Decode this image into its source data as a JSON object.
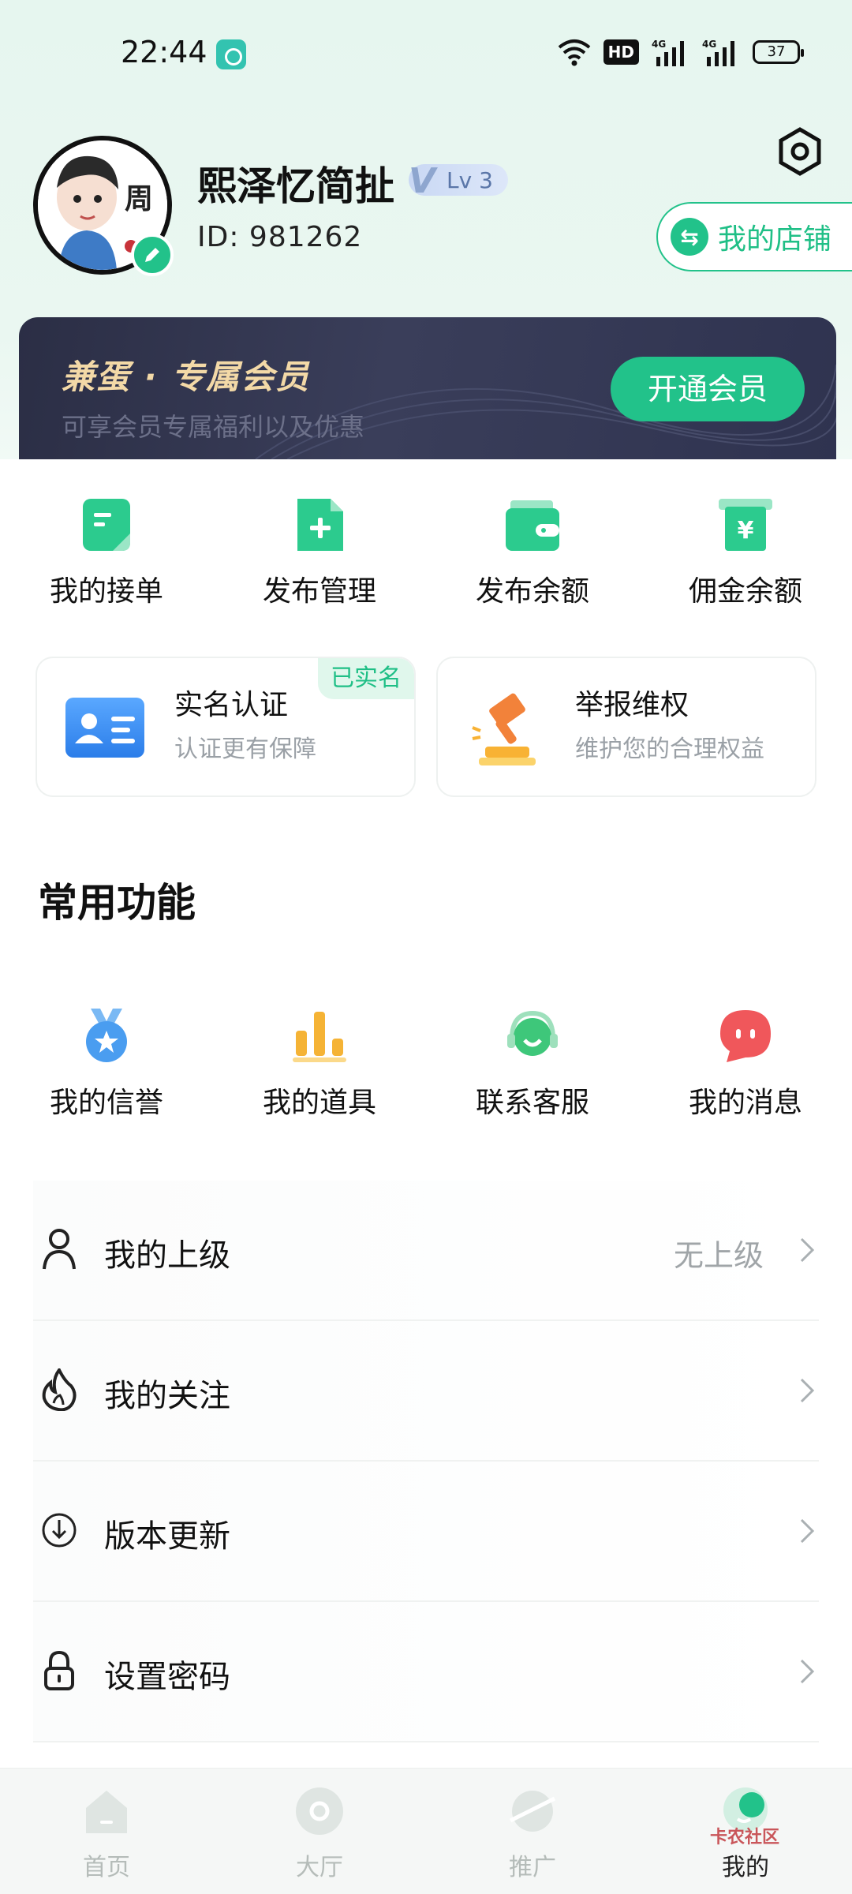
{
  "status_bar": {
    "time": "22:44",
    "hd_label": "HD",
    "battery": "37"
  },
  "profile": {
    "username": "熙泽忆简扯",
    "level": "Lv 3",
    "level_prefix": "V",
    "id_text": "ID:  981262",
    "avatar_text": "周",
    "shop_label": "我的店铺"
  },
  "vip": {
    "title": "兼蛋 · 专属会员",
    "subtitle": "可享会员专属福利以及优惠",
    "button_label": "开通会员"
  },
  "quick_actions": [
    {
      "label": "我的接单",
      "icon": "order-icon"
    },
    {
      "label": "发布管理",
      "icon": "publish-icon"
    },
    {
      "label": "发布余额",
      "icon": "wallet-icon"
    },
    {
      "label": "佣金余额",
      "icon": "commission-icon"
    }
  ],
  "cards": {
    "verify": {
      "title": "实名认证",
      "subtitle": "认证更有保障",
      "tag": "已实名",
      "icon": "id-card-icon"
    },
    "report": {
      "title": "举报维权",
      "subtitle": "维护您的合理权益",
      "icon": "gavel-icon"
    }
  },
  "section_title": "常用功能",
  "functions": [
    {
      "label": "我的信誉",
      "icon": "medal-icon",
      "color": "#4a9df0"
    },
    {
      "label": "我的道具",
      "icon": "bar-chart-icon",
      "color": "#f5b335"
    },
    {
      "label": "联系客服",
      "icon": "headset-icon",
      "color": "#3ec77a"
    },
    {
      "label": "我的消息",
      "icon": "message-icon",
      "color": "#f0575b"
    }
  ],
  "list": [
    {
      "label": "我的上级",
      "value": "无上级",
      "icon": "person-icon"
    },
    {
      "label": "我的关注",
      "value": "",
      "icon": "flame-icon"
    },
    {
      "label": "版本更新",
      "value": "",
      "icon": "download-icon"
    },
    {
      "label": "设置密码",
      "value": "",
      "icon": "lock-icon"
    }
  ],
  "bottom_nav": [
    {
      "label": "首页",
      "icon": "home-icon",
      "active": false
    },
    {
      "label": "大厅",
      "icon": "hall-icon",
      "active": false
    },
    {
      "label": "推广",
      "icon": "planet-icon",
      "active": false
    },
    {
      "label": "我的",
      "icon": "me-icon",
      "active": true
    }
  ],
  "watermark": "卡农社区",
  "colors": {
    "accent": "#22c28a",
    "vip_gold": "#f3d9a7",
    "vip_bg": "#2f3350"
  }
}
